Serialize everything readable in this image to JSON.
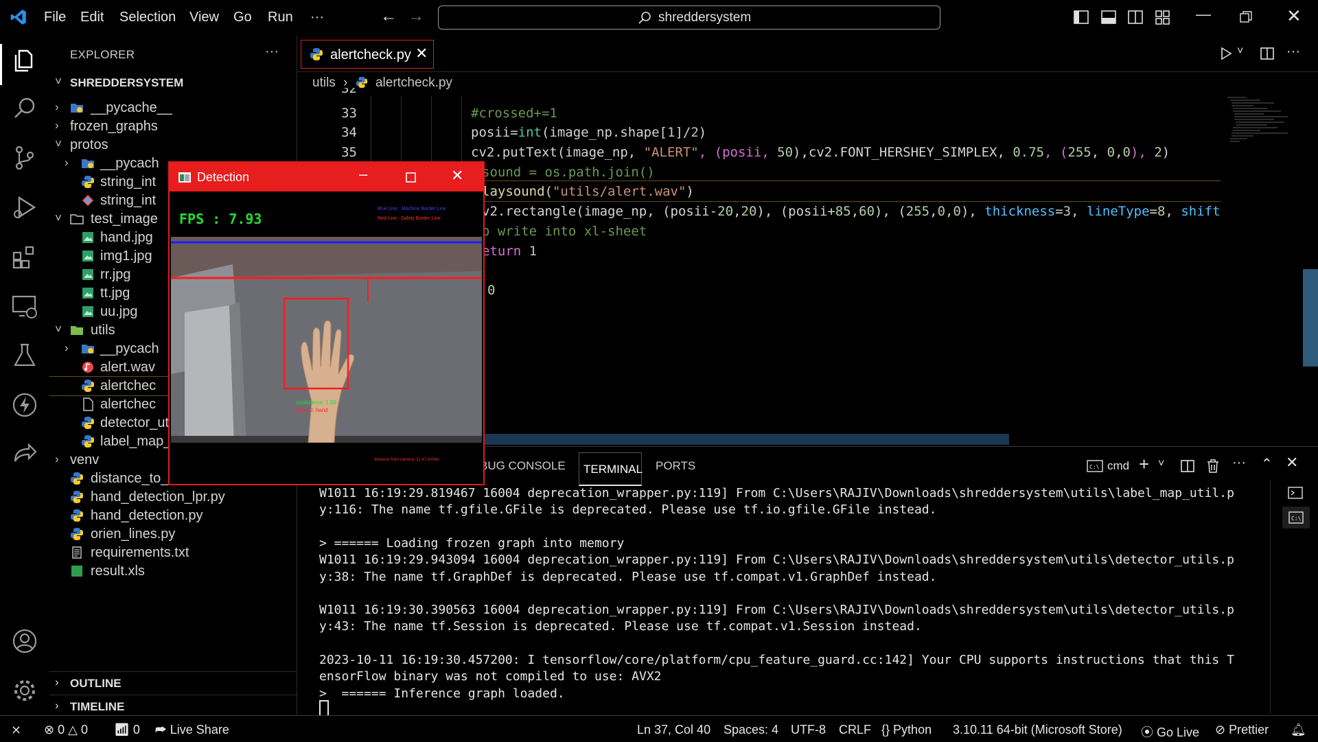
{
  "titlebar": {
    "menu": [
      "File",
      "Edit",
      "Selection",
      "View",
      "Go",
      "Run",
      "···"
    ],
    "search": "shreddersystem"
  },
  "explorer": {
    "header": "EXPLORER",
    "more": "···",
    "root": "SHREDDERSYSTEM",
    "rows": [
      {
        "label": "__pycache__",
        "depth": 1,
        "kind": "folder-py",
        "chev": "›"
      },
      {
        "label": "frozen_graphs",
        "depth": 1,
        "kind": "none",
        "chev": "›"
      },
      {
        "label": "protos",
        "depth": 1,
        "kind": "none",
        "chev": "˅"
      },
      {
        "label": "__pycach",
        "depth": 2,
        "kind": "folder-py",
        "chev": "›"
      },
      {
        "label": "string_int",
        "depth": 2,
        "kind": "python",
        "chev": ""
      },
      {
        "label": "string_int",
        "depth": 2,
        "kind": "proto",
        "chev": ""
      },
      {
        "label": "test_image",
        "depth": 1,
        "kind": "folder",
        "chev": "˅"
      },
      {
        "label": "hand.jpg",
        "depth": 2,
        "kind": "image",
        "chev": ""
      },
      {
        "label": "img1.jpg",
        "depth": 2,
        "kind": "image",
        "chev": ""
      },
      {
        "label": "rr.jpg",
        "depth": 2,
        "kind": "image",
        "chev": ""
      },
      {
        "label": "tt.jpg",
        "depth": 2,
        "kind": "image",
        "chev": ""
      },
      {
        "label": "uu.jpg",
        "depth": 2,
        "kind": "image",
        "chev": ""
      },
      {
        "label": "utils",
        "depth": 1,
        "kind": "folder-green",
        "chev": "˅"
      },
      {
        "label": "__pycach",
        "depth": 2,
        "kind": "folder-py",
        "chev": "›"
      },
      {
        "label": "alert.wav",
        "depth": 2,
        "kind": "audio",
        "chev": ""
      },
      {
        "label": "alertchec",
        "depth": 2,
        "kind": "python",
        "chev": "",
        "selected": true
      },
      {
        "label": "alertchec",
        "depth": 2,
        "kind": "file",
        "chev": ""
      },
      {
        "label": "detector_utils.py",
        "depth": 2,
        "kind": "python",
        "chev": ""
      },
      {
        "label": "label_map_util.py",
        "depth": 2,
        "kind": "python",
        "chev": ""
      },
      {
        "label": "venv",
        "depth": 1,
        "kind": "none",
        "chev": "›"
      },
      {
        "label": "distance_to_camera.py",
        "depth": 1,
        "kind": "python",
        "chev": ""
      },
      {
        "label": "hand_detection_lpr.py",
        "depth": 1,
        "kind": "python",
        "chev": ""
      },
      {
        "label": "hand_detection.py",
        "depth": 1,
        "kind": "python",
        "chev": ""
      },
      {
        "label": "orien_lines.py",
        "depth": 1,
        "kind": "python",
        "chev": ""
      },
      {
        "label": "requirements.txt",
        "depth": 1,
        "kind": "text",
        "chev": ""
      },
      {
        "label": "result.xls",
        "depth": 1,
        "kind": "sheet",
        "chev": ""
      }
    ],
    "sections": [
      "OUTLINE",
      "TIMELINE"
    ]
  },
  "editor": {
    "tab": "alertcheck.py",
    "breadcrumb": [
      "utils",
      "alertcheck.py"
    ],
    "line_numbers": [
      "32",
      "33",
      "34",
      "35"
    ],
    "code": {
      "l33": "#crossed+=1",
      "l34_a": "posii=",
      "l34_b": "int",
      "l34_c": "(image_np.shape[",
      "l34_d": "1",
      "l34_e": "]/",
      "l34_f": "2",
      "l34_g": ")",
      "l35_a": "cv2.putText(image_np, ",
      "l35_b": "\"ALERT\"",
      "l35_c": ", (posii, ",
      "l35_d": "50",
      "l35_e": "),cv2.FONT_HERSHEY_SIMPLEX, ",
      "l35_f": "0.75",
      "l35_g": ", (",
      "l35_h": "255",
      "l35_i": ", ",
      "l35_j": "0",
      "l35_k": ",",
      "l35_l": "0",
      "l35_m": "), ",
      "l35_n": "2",
      "l35_o": ")",
      "l36": "sound = os.path.join()",
      "l37_a": "laysound(",
      "l37_b": "\"utils/alert.wav\"",
      "l37_c": ")",
      "l38_a": "v2.rectangle(image_np, (posii-",
      "l38_b": "20",
      "l38_c": ",",
      "l38_d": "20",
      "l38_e": "), (posii+",
      "l38_f": "85",
      "l38_g": ",",
      "l38_h": "60",
      "l38_i": "), (",
      "l38_j": "255",
      "l38_k": ",",
      "l38_l": "0",
      "l38_m": ",",
      "l38_n": "0",
      "l38_o": "), ",
      "l38_p": "thickness",
      "l38_q": "=",
      "l38_r": "3",
      "l38_s": ", ",
      "l38_t": "lineType",
      "l38_u": "=",
      "l38_v": "8",
      "l38_w": ", ",
      "l38_x": "shift",
      "l39": "o write into xl-sheet",
      "l40_a": "eturn ",
      "l40_b": "1",
      "l42": "0"
    }
  },
  "panel": {
    "tabs": [
      "BUG CONSOLE",
      "TERMINAL",
      "PORTS"
    ],
    "shell": "cmd",
    "terminal_lines": [
      "W1011 16:19:29.819467 16004 deprecation_wrapper.py:119] From C:\\Users\\RAJIV\\Downloads\\shreddersystem\\utils\\label_map_util.p",
      "y:116: The name tf.gfile.GFile is deprecated. Please use tf.io.gfile.GFile instead.",
      "",
      "> ====== Loading frozen graph into memory",
      "W1011 16:19:29.943094 16004 deprecation_wrapper.py:119] From C:\\Users\\RAJIV\\Downloads\\shreddersystem\\utils\\detector_utils.p",
      "y:38: The name tf.GraphDef is deprecated. Please use tf.compat.v1.GraphDef instead.",
      "",
      "W1011 16:19:30.390563 16004 deprecation_wrapper.py:119] From C:\\Users\\RAJIV\\Downloads\\shreddersystem\\utils\\detector_utils.p",
      "y:43: The name tf.Session is deprecated. Please use tf.compat.v1.Session instead.",
      "",
      "2023-10-11 16:19:30.457200: I tensorflow/core/platform/cpu_feature_guard.cc:142] Your CPU supports instructions that this T",
      "ensorFlow binary was not compiled to use: AVX2",
      ">  ====== Inference graph loaded."
    ]
  },
  "statusbar": {
    "errors": "0",
    "warnings": "0",
    "ports": "0",
    "live_share": "Live Share",
    "position": "Ln 37, Col 40",
    "spaces": "Spaces: 4",
    "encoding": "UTF-8",
    "eol": "CRLF",
    "language": "Python",
    "interpreter": "3.10.11 64-bit (Microsoft Store)",
    "go_live": "Go Live",
    "prettier": "Prettier"
  },
  "detection": {
    "title": "Detection",
    "fps": "FPS : 7.93",
    "legend_blue": "Blue Line : Machine Border Line",
    "legend_red": "Red Line : Safety Border Line",
    "confidence": "confidence: 1.00",
    "label": "hand 0: hand",
    "distance": "distance from camera: 21.47 inches"
  }
}
